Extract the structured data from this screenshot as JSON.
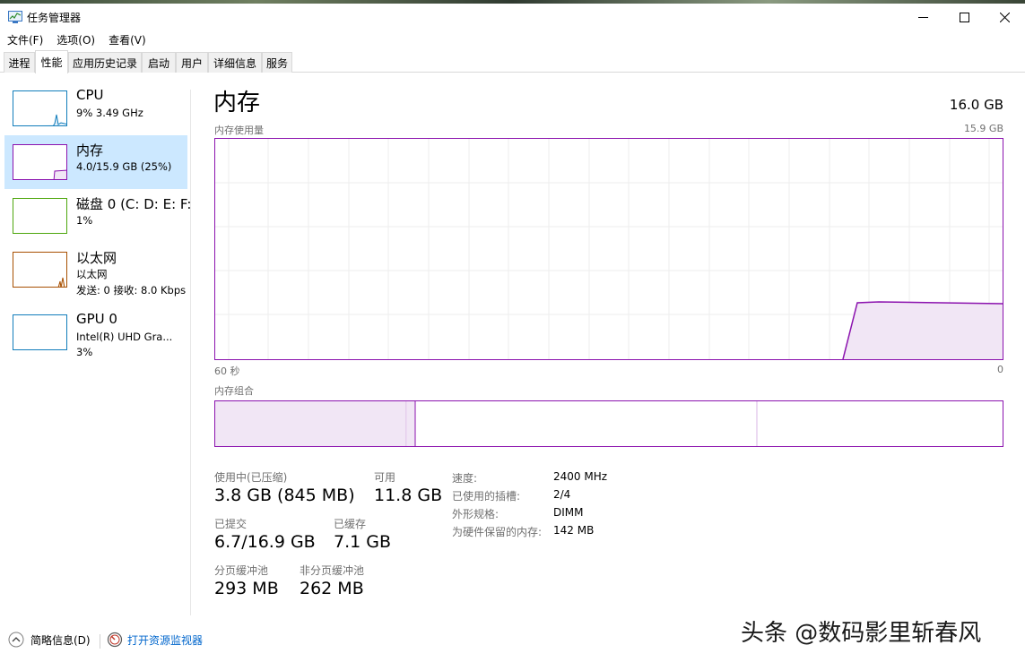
{
  "window": {
    "title": "任务管理器",
    "controls": [
      "minimize",
      "maximize",
      "close"
    ]
  },
  "menu": {
    "items": [
      "文件(F)",
      "选项(O)",
      "查看(V)"
    ]
  },
  "tabs": [
    "进程",
    "性能",
    "应用历史记录",
    "启动",
    "用户",
    "详细信息",
    "服务"
  ],
  "active_tab": "性能",
  "sidebar": {
    "items": [
      {
        "title": "CPU",
        "sub1": "9% 3.49 GHz",
        "sub2": "",
        "color": "#117dbb",
        "selected": false
      },
      {
        "title": "内存",
        "sub1": "4.0/15.9 GB (25%)",
        "sub2": "",
        "color": "#8b12ae",
        "selected": true
      },
      {
        "title": "磁盘 0 (C: D: E: F:",
        "sub1": "1%",
        "sub2": "",
        "color": "#4da60c",
        "selected": false
      },
      {
        "title": "以太网",
        "sub1": "以太网",
        "sub2": "发送: 0 接收: 8.0 Kbps",
        "color": "#a74f01",
        "selected": false
      },
      {
        "title": "GPU 0",
        "sub1": "Intel(R) UHD Gra...",
        "sub2": "3%",
        "color": "#117dbb",
        "selected": false
      }
    ]
  },
  "main": {
    "title": "内存",
    "total": "16.0 GB",
    "usage_label": "内存使用量",
    "usage_max": "15.9 GB",
    "time_left": "60 秒",
    "time_right": "0",
    "composition_label": "内存组合",
    "accent_color": "#8b12ae",
    "composition": {
      "in_use_fraction": 0.24,
      "modified_fraction": 0.013,
      "standby_fraction": 0.435,
      "free_fraction": 0.312
    }
  },
  "stats": {
    "in_use_label": "使用中(已压缩)",
    "in_use_value": "3.8 GB (845 MB)",
    "available_label": "可用",
    "available_value": "11.8 GB",
    "committed_label": "已提交",
    "committed_value": "6.7/16.9 GB",
    "cached_label": "已缓存",
    "cached_value": "7.1 GB",
    "paged_label": "分页缓冲池",
    "paged_value": "293 MB",
    "nonpaged_label": "非分页缓冲池",
    "nonpaged_value": "262 MB"
  },
  "info": {
    "speed_label": "速度:",
    "speed_value": "2400 MHz",
    "slots_label": "已使用的插槽:",
    "slots_value": "2/4",
    "form_label": "外形规格:",
    "form_value": "DIMM",
    "reserved_label": "为硬件保留的内存:",
    "reserved_value": "142 MB"
  },
  "footer": {
    "fewer_details": "简略信息(D)",
    "resource_monitor": "打开资源监视器"
  },
  "watermark": "头条 @数码影里斩春风"
}
